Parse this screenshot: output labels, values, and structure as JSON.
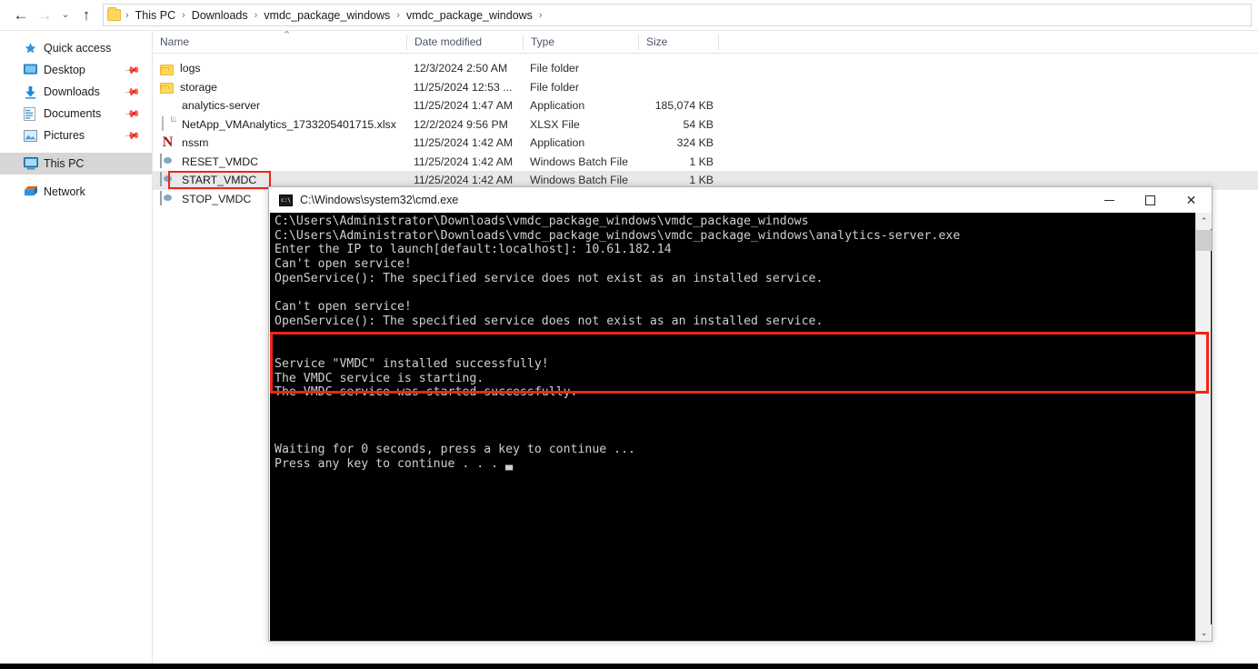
{
  "window": {
    "nav": {
      "back_icon": "arrow-left-icon",
      "forward_icon": "arrow-right-icon",
      "history_icon": "chevron-down-icon",
      "up_icon": "arrow-up-icon"
    },
    "address_bar": {
      "folder_icon": "folder-icon",
      "crumbs": [
        "This PC",
        "Downloads",
        "vmdc_package_windows",
        "vmdc_package_windows"
      ],
      "separator": "›"
    }
  },
  "sidebar": {
    "items": [
      {
        "label": "Quick access",
        "icon": "star-icon",
        "pinned": false,
        "selected": false
      },
      {
        "label": "Desktop",
        "icon": "desktop-icon",
        "pinned": true,
        "selected": false
      },
      {
        "label": "Downloads",
        "icon": "download-icon",
        "pinned": true,
        "selected": false
      },
      {
        "label": "Documents",
        "icon": "documents-icon",
        "pinned": true,
        "selected": false
      },
      {
        "label": "Pictures",
        "icon": "pictures-icon",
        "pinned": true,
        "selected": false
      },
      {
        "label": "This PC",
        "icon": "computer-icon",
        "pinned": false,
        "selected": true
      },
      {
        "label": "Network",
        "icon": "network-icon",
        "pinned": false,
        "selected": false
      }
    ],
    "pin_icon": "pin-icon"
  },
  "file_list": {
    "columns": [
      "Name",
      "Date modified",
      "Type",
      "Size"
    ],
    "sort_indicator": "chevron-up-icon",
    "rows": [
      {
        "name": "logs",
        "date": "12/3/2024 2:50 AM",
        "type": "File folder",
        "size": "",
        "icon": "folder-icon",
        "selected": false
      },
      {
        "name": "storage",
        "date": "11/25/2024 12:53 ...",
        "type": "File folder",
        "size": "",
        "icon": "folder-icon",
        "selected": false
      },
      {
        "name": "analytics-server",
        "date": "11/25/2024 1:47 AM",
        "type": "Application",
        "size": "185,074 KB",
        "icon": "green-hexagon-icon",
        "selected": false
      },
      {
        "name": "NetApp_VMAnalytics_1733205401715.xlsx",
        "date": "12/2/2024 9:56 PM",
        "type": "XLSX File",
        "size": "54 KB",
        "icon": "document-icon",
        "selected": false
      },
      {
        "name": "nssm",
        "date": "11/25/2024 1:42 AM",
        "type": "Application",
        "size": "324 KB",
        "icon": "letter-n-icon",
        "selected": false
      },
      {
        "name": "RESET_VMDC",
        "date": "11/25/2024 1:42 AM",
        "type": "Windows Batch File",
        "size": "1 KB",
        "icon": "batch-file-icon",
        "selected": false
      },
      {
        "name": "START_VMDC",
        "date": "11/25/2024 1:42 AM",
        "type": "Windows Batch File",
        "size": "1 KB",
        "icon": "batch-file-icon",
        "selected": true
      },
      {
        "name": "STOP_VMDC",
        "date": "",
        "type": "",
        "size": "",
        "icon": "batch-file-icon",
        "selected": false
      }
    ]
  },
  "cmd_window": {
    "title": "C:\\Windows\\system32\\cmd.exe",
    "title_icon": "cmd-icon",
    "minimize_label": "—",
    "maximize_label": "□",
    "close_label": "✕",
    "console_output": "C:\\Users\\Administrator\\Downloads\\vmdc_package_windows\\vmdc_package_windows\nC:\\Users\\Administrator\\Downloads\\vmdc_package_windows\\vmdc_package_windows\\analytics-server.exe\nEnter the IP to launch[default:localhost]: 10.61.182.14\nCan't open service!\nOpenService(): The specified service does not exist as an installed service.\n\nCan't open service!\nOpenService(): The specified service does not exist as an installed service.\n\n\nService \"VMDC\" installed successfully!\nThe VMDC service is starting.\nThe VMDC service was started successfully.\n\n\n\nWaiting for 0 seconds, press a key to continue ...\nPress any key to continue . . . ▃",
    "scrollbar": {
      "up_arrow": "⌃",
      "down_arrow": "⌄"
    }
  },
  "annotations": {
    "highlight_color": "#ef2515",
    "start_vmdc_box": "red-rectangle-around-start-vmdc",
    "console_success_box": "red-rectangle-around-service-started-messages"
  }
}
